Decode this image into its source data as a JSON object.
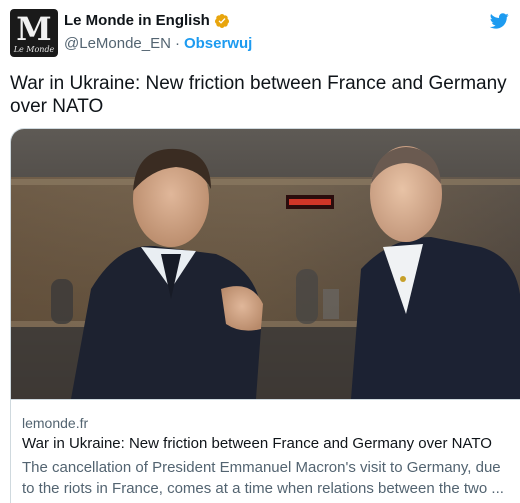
{
  "account": {
    "name": "Le Monde in English",
    "handle": "@LeMonde_EN",
    "separator": "·",
    "follow_label": "Obserwuj",
    "avatar_letter": "M",
    "avatar_wordmark": "Le Monde",
    "verified_icon": "verified-badge-icon",
    "platform_icon": "twitter-bird-icon"
  },
  "tweet": {
    "text": "War in Ukraine: New friction between France and Germany over NATO"
  },
  "card": {
    "domain": "lemonde.fr",
    "title": "War in Ukraine: New friction between France and Germany over NATO",
    "description": "The cancellation of President Emmanuel Macron's visit to Germany, due to the riots in France, comes at a time when relations between the two ..."
  },
  "colors": {
    "accent": "#1d9bf0",
    "verified": "#e8a50d",
    "text_primary": "#0f1419",
    "text_secondary": "#536471",
    "border": "#cfd9de"
  }
}
